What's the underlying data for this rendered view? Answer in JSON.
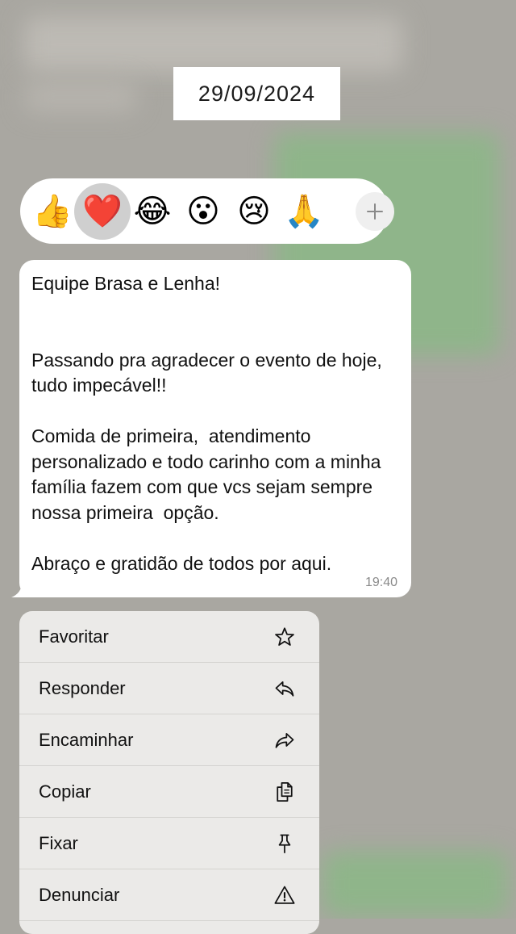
{
  "date_label": "29/09/2024",
  "reactions": {
    "items": [
      {
        "name": "thumbs-up",
        "glyph": "👍",
        "selected": false
      },
      {
        "name": "heart",
        "glyph": "❤️",
        "selected": true
      },
      {
        "name": "joy",
        "glyph": "😂",
        "selected": false
      },
      {
        "name": "astonished",
        "glyph": "😮",
        "selected": false
      },
      {
        "name": "cry",
        "glyph": "😢",
        "selected": false
      },
      {
        "name": "pray",
        "glyph": "🙏",
        "selected": false
      }
    ],
    "more_icon": "plus-icon"
  },
  "message": {
    "lines": [
      "Equipe Brasa e Lenha!",
      "",
      "",
      "Passando pra agradecer o evento de hoje,",
      "tudo impecável!!",
      "",
      "Comida de primeira,  atendimento",
      "personalizado e todo carinho com a minha",
      "família fazem com que vcs sejam sempre",
      "nossa primeira  opção.",
      "",
      "Abraço e gratidão de todos por aqui."
    ],
    "time": "19:40"
  },
  "menu": {
    "items": [
      {
        "label": "Favoritar",
        "icon": "star-icon"
      },
      {
        "label": "Responder",
        "icon": "reply-icon"
      },
      {
        "label": "Encaminhar",
        "icon": "forward-icon"
      },
      {
        "label": "Copiar",
        "icon": "copy-icon"
      },
      {
        "label": "Fixar",
        "icon": "pin-icon"
      },
      {
        "label": "Denunciar",
        "icon": "warning-icon"
      }
    ]
  },
  "colors": {
    "backdrop": "#a9a7a1",
    "bubble": "#ffffff",
    "menu": "#ebeae8",
    "reaction_selected": "#cfcfcf"
  }
}
